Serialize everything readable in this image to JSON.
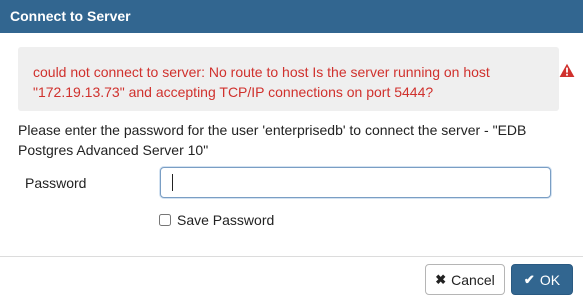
{
  "dialog": {
    "title": "Connect to Server"
  },
  "error": {
    "message": "could not connect to server: No route to host Is the server running on host \"172.19.13.73\" and accepting TCP/IP connections on port 5444?",
    "icon": "warning-triangle-icon"
  },
  "prompt": {
    "text": "Please enter the password for the user 'enterprisedb' to connect the server - \"EDB Postgres Advanced Server 10\""
  },
  "password": {
    "label": "Password",
    "value": "",
    "placeholder": ""
  },
  "save_password": {
    "label": "Save Password",
    "checked": false
  },
  "buttons": {
    "cancel_label": "Cancel",
    "cancel_icon": "close-icon",
    "ok_label": "OK",
    "ok_icon": "check-icon"
  },
  "colors": {
    "title_bar": "#326690",
    "error_text": "#d0312d",
    "error_background": "#efefef",
    "ok_button": "#326690"
  }
}
